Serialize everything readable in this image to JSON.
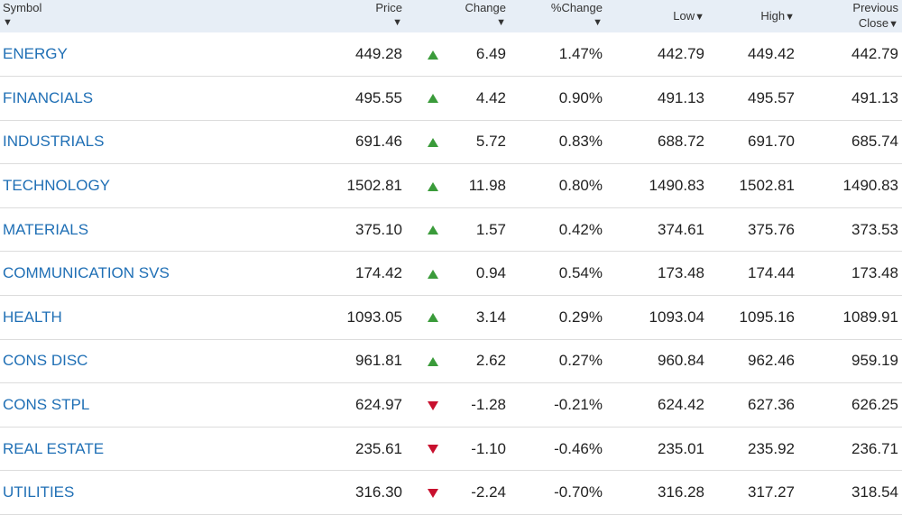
{
  "columns": {
    "symbol": "Symbol",
    "price": "Price",
    "change": "Change",
    "pct_change": "%Change",
    "low": "Low",
    "high": "High",
    "prev_close_1": "Previous",
    "prev_close_2": "Close"
  },
  "colors": {
    "up": "#3a9b3a",
    "down": "#c8102e",
    "link": "#1f6fb5",
    "header_bg": "#e7eef6"
  },
  "rows": [
    {
      "symbol": "ENERGY",
      "price": "449.28",
      "direction": "up",
      "change": "6.49",
      "pct": "1.47%",
      "low": "442.79",
      "high": "449.42",
      "prev": "442.79"
    },
    {
      "symbol": "FINANCIALS",
      "price": "495.55",
      "direction": "up",
      "change": "4.42",
      "pct": "0.90%",
      "low": "491.13",
      "high": "495.57",
      "prev": "491.13"
    },
    {
      "symbol": "INDUSTRIALS",
      "price": "691.46",
      "direction": "up",
      "change": "5.72",
      "pct": "0.83%",
      "low": "688.72",
      "high": "691.70",
      "prev": "685.74"
    },
    {
      "symbol": "TECHNOLOGY",
      "price": "1502.81",
      "direction": "up",
      "change": "11.98",
      "pct": "0.80%",
      "low": "1490.83",
      "high": "1502.81",
      "prev": "1490.83"
    },
    {
      "symbol": "MATERIALS",
      "price": "375.10",
      "direction": "up",
      "change": "1.57",
      "pct": "0.42%",
      "low": "374.61",
      "high": "375.76",
      "prev": "373.53"
    },
    {
      "symbol": "COMMUNICATION SVS",
      "price": "174.42",
      "direction": "up",
      "change": "0.94",
      "pct": "0.54%",
      "low": "173.48",
      "high": "174.44",
      "prev": "173.48"
    },
    {
      "symbol": "HEALTH",
      "price": "1093.05",
      "direction": "up",
      "change": "3.14",
      "pct": "0.29%",
      "low": "1093.04",
      "high": "1095.16",
      "prev": "1089.91"
    },
    {
      "symbol": "CONS DISC",
      "price": "961.81",
      "direction": "up",
      "change": "2.62",
      "pct": "0.27%",
      "low": "960.84",
      "high": "962.46",
      "prev": "959.19"
    },
    {
      "symbol": "CONS STPL",
      "price": "624.97",
      "direction": "down",
      "change": "-1.28",
      "pct": "-0.21%",
      "low": "624.42",
      "high": "627.36",
      "prev": "626.25"
    },
    {
      "symbol": "REAL ESTATE",
      "price": "235.61",
      "direction": "down",
      "change": "-1.10",
      "pct": "-0.46%",
      "low": "235.01",
      "high": "235.92",
      "prev": "236.71"
    },
    {
      "symbol": "UTILITIES",
      "price": "316.30",
      "direction": "down",
      "change": "-2.24",
      "pct": "-0.70%",
      "low": "316.28",
      "high": "317.27",
      "prev": "318.54"
    }
  ]
}
